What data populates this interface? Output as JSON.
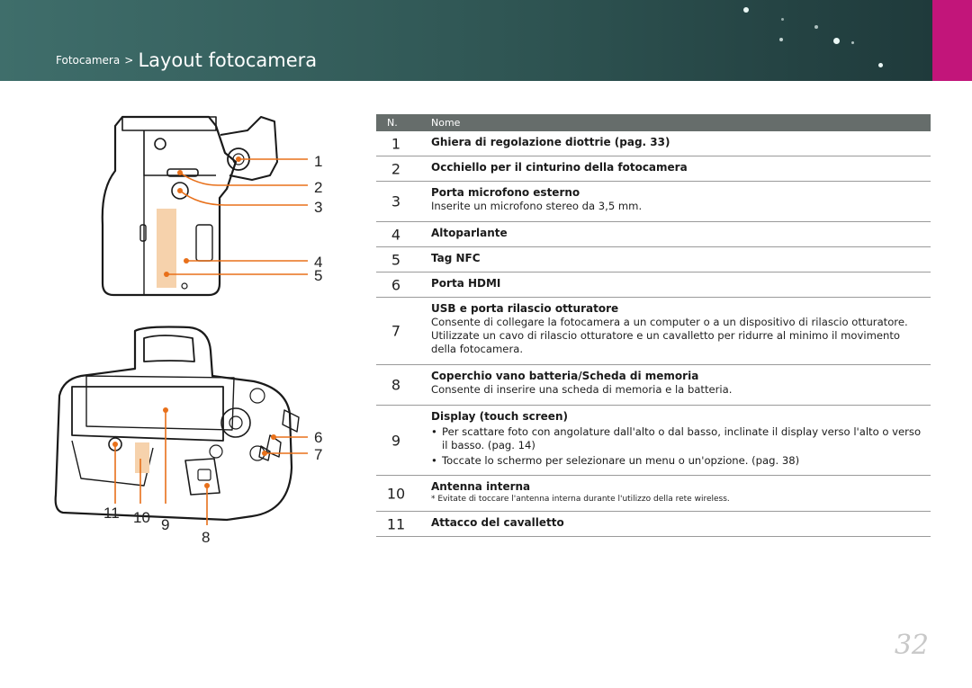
{
  "header": {
    "breadcrumb_parent": "Fotocamera",
    "breadcrumb_sep": ">",
    "title": "Layout fotocamera",
    "accent_color": "#c2157a",
    "band_color": "#3f6e6b"
  },
  "table": {
    "col_num": "N.",
    "col_name": "Nome",
    "rows": [
      {
        "n": "1",
        "title": "Ghiera di regolazione diottrie (pag. 33)"
      },
      {
        "n": "2",
        "title": "Occhiello per il cinturino della fotocamera"
      },
      {
        "n": "3",
        "title": "Porta microfono esterno",
        "desc": "Inserite un microfono stereo da 3,5 mm."
      },
      {
        "n": "4",
        "title": "Altoparlante"
      },
      {
        "n": "5",
        "title": "Tag NFC"
      },
      {
        "n": "6",
        "title": "Porta HDMI"
      },
      {
        "n": "7",
        "title": "USB e porta rilascio otturatore",
        "desc": "Consente di collegare la fotocamera a un computer o a un dispositivo di rilascio otturatore. Utilizzate un cavo di rilascio otturatore e un cavalletto per ridurre al minimo il movimento della fotocamera."
      },
      {
        "n": "8",
        "title": "Coperchio vano batteria/Scheda di memoria",
        "desc": "Consente di inserire una scheda di memoria e la batteria."
      },
      {
        "n": "9",
        "title": "Display (touch screen)",
        "bullet1": "Per scattare foto con angolature dall'alto o dal basso, inclinate il display verso l'alto o verso il basso. (pag. 14)",
        "bullet2": "Toccate lo schermo per selezionare un menu o un'opzione. (pag. 38)"
      },
      {
        "n": "10",
        "title": "Antenna interna",
        "note": "* Evitate di toccare l'antenna interna durante l'utilizzo della rete wireless."
      },
      {
        "n": "11",
        "title": "Attacco del cavalletto"
      }
    ]
  },
  "figure_labels": {
    "l1": "1",
    "l2": "2",
    "l3": "3",
    "l4": "4",
    "l5": "5",
    "l6": "6",
    "l7": "7",
    "l8": "8",
    "l9": "9",
    "l10": "10",
    "l11": "11"
  },
  "callout_color": "#e8701a",
  "highlight_color": "#f6d2ac",
  "page_number": "32"
}
